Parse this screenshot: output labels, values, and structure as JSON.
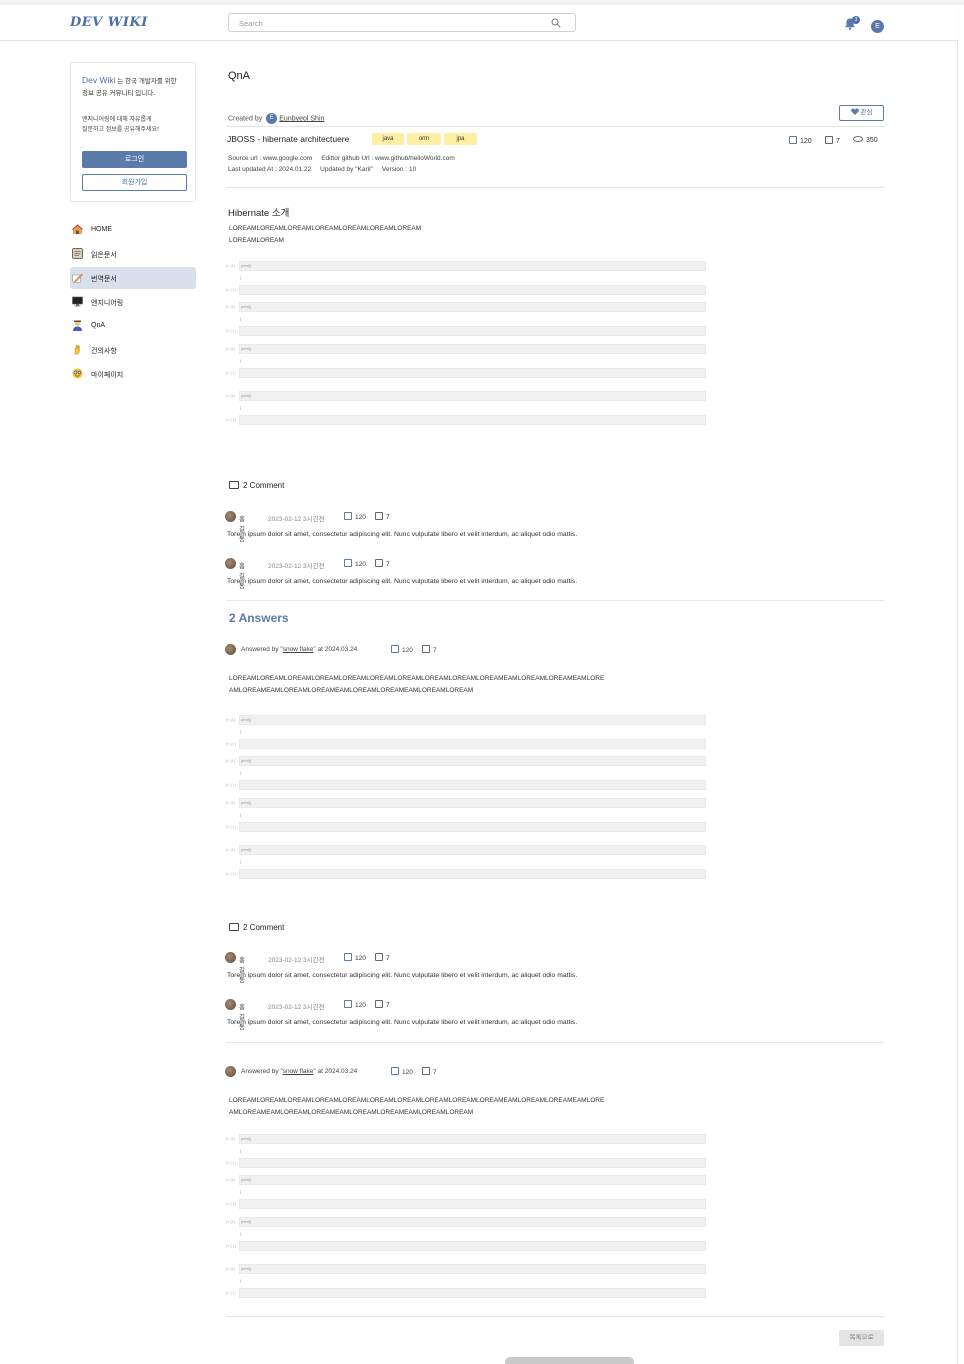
{
  "header": {
    "logo": "DEV WIKI",
    "search_placeholder": "Search",
    "notification_count": "3",
    "user_initial": "E"
  },
  "sidebar": {
    "intro_brand": "Dev Wiki",
    "intro_text1": " 는 한국 개발자를 위한",
    "intro_text2": "정보 공유 커뮤니티 입니다.",
    "sub_text1": "엔지니어링에 대해 자유롭게",
    "sub_text2": "질문하고 정보를 공유해주세요!",
    "login_label": "로그인",
    "signup_label": "회원가입",
    "items": [
      {
        "label": "HOME",
        "icon": "house-icon"
      },
      {
        "label": "읽은문서",
        "icon": "document-icon"
      },
      {
        "label": "번역문서",
        "icon": "pencil-icon"
      },
      {
        "label": "엔지니어링",
        "icon": "monitor-icon"
      },
      {
        "label": "QnA",
        "icon": "person-question-icon"
      },
      {
        "label": "건의사항",
        "icon": "raised-hand-icon"
      },
      {
        "label": "마이페이지",
        "icon": "smiley-glasses-icon"
      }
    ]
  },
  "doc": {
    "page_title": "QnA",
    "favorite_label": "관심",
    "created_by_label": "Created by",
    "author_initial": "E",
    "author": "Eunbyeol Shin",
    "title": "JBOSS - hibernate architectuere",
    "tags": [
      "java",
      "orm",
      "jpa"
    ],
    "likes": "120",
    "dislikes": "7",
    "views": "350",
    "meta_line1": "Source url : www.google.com     Edittor github Url : www.github/helloWorld.com",
    "meta_line2": "Last updated At : 2024.01.22     Updated by \"Karil\"     Version : 10",
    "section_title": "Hibernate 소개",
    "lorem1": "LOREAMLOREAMLOREAMLOREAMLOREAMLOREAMLOREAM",
    "lorem2": "LOREAMLOREAM"
  },
  "code": {
    "gutter_a": "|< |1|",
    "gutter_b": "|< | ) |",
    "line_text": "print()",
    "brace": "}"
  },
  "question_comments": {
    "header": "2 Comment",
    "items": [
      {
        "name": "홍길동",
        "date": "2023-02-12  3시간전",
        "likes": "120",
        "dislikes": "7",
        "body": "Torem ipsum dolor sit amet, consectetur adipiscing elit. Nunc vulputate libero et velit interdum, ac aliquet odio mattis."
      },
      {
        "name": "홍길동",
        "date": "2023-02-12  3시간전",
        "likes": "120",
        "dislikes": "7",
        "body": "Torem ipsum dolor sit amet, consectetur adipiscing elit. Nunc vulputate libero et velit interdum, ac aliquet odio mattis."
      }
    ]
  },
  "answers": {
    "title": "2 Answers",
    "items": [
      {
        "answered_by": "Answered by \"",
        "user": "snow flake",
        "at": "\" at 2024.03.24",
        "likes": "120",
        "dislikes": "7",
        "lorem1": "LOREAMLOREAMLOREAMLOREAMLOREAMLOREAMLOREAMLOREAMLOREAMLOREAMEAMLOREAMLOREAMEAMLORE",
        "lorem2": "AMLOREAMEAMLOREAMLOREAMEAMLOREAMLOREAMEAMLOREAMLOREAM",
        "comments_header": "2 Comment",
        "comments": [
          {
            "name": "홍길동",
            "date": "2023-02-12  3시간전",
            "likes": "120",
            "dislikes": "7",
            "body": "Torem ipsum dolor sit amet, consectetur adipiscing elit. Nunc vulputate libero et velit interdum, ac aliquet odio mattis."
          },
          {
            "name": "홍길동",
            "date": "2023-02-12  3시간전",
            "likes": "120",
            "dislikes": "7",
            "body": "Torem ipsum dolor sit amet, consectetur adipiscing elit. Nunc vulputate libero et velit interdum, ac aliquet odio mattis."
          }
        ]
      },
      {
        "answered_by": "Answered by \"",
        "user": "snow flake",
        "at": "\" at 2024.03.24",
        "likes": "120",
        "dislikes": "7",
        "lorem1": "LOREAMLOREAMLOREAMLOREAMLOREAMLOREAMLOREAMLOREAMLOREAMLOREAMEAMLOREAMLOREAMEAMLORE",
        "lorem2": "AMLOREAMEAMLOREAMLOREAMEAMLOREAMLOREAMEAMLOREAMLOREAM"
      }
    ]
  },
  "footer": {
    "list_button": "목록으로"
  },
  "colors": {
    "accent": "#5b7bab",
    "tag_bg": "#fdf0a5",
    "active_nav": "#d8e0ec"
  }
}
